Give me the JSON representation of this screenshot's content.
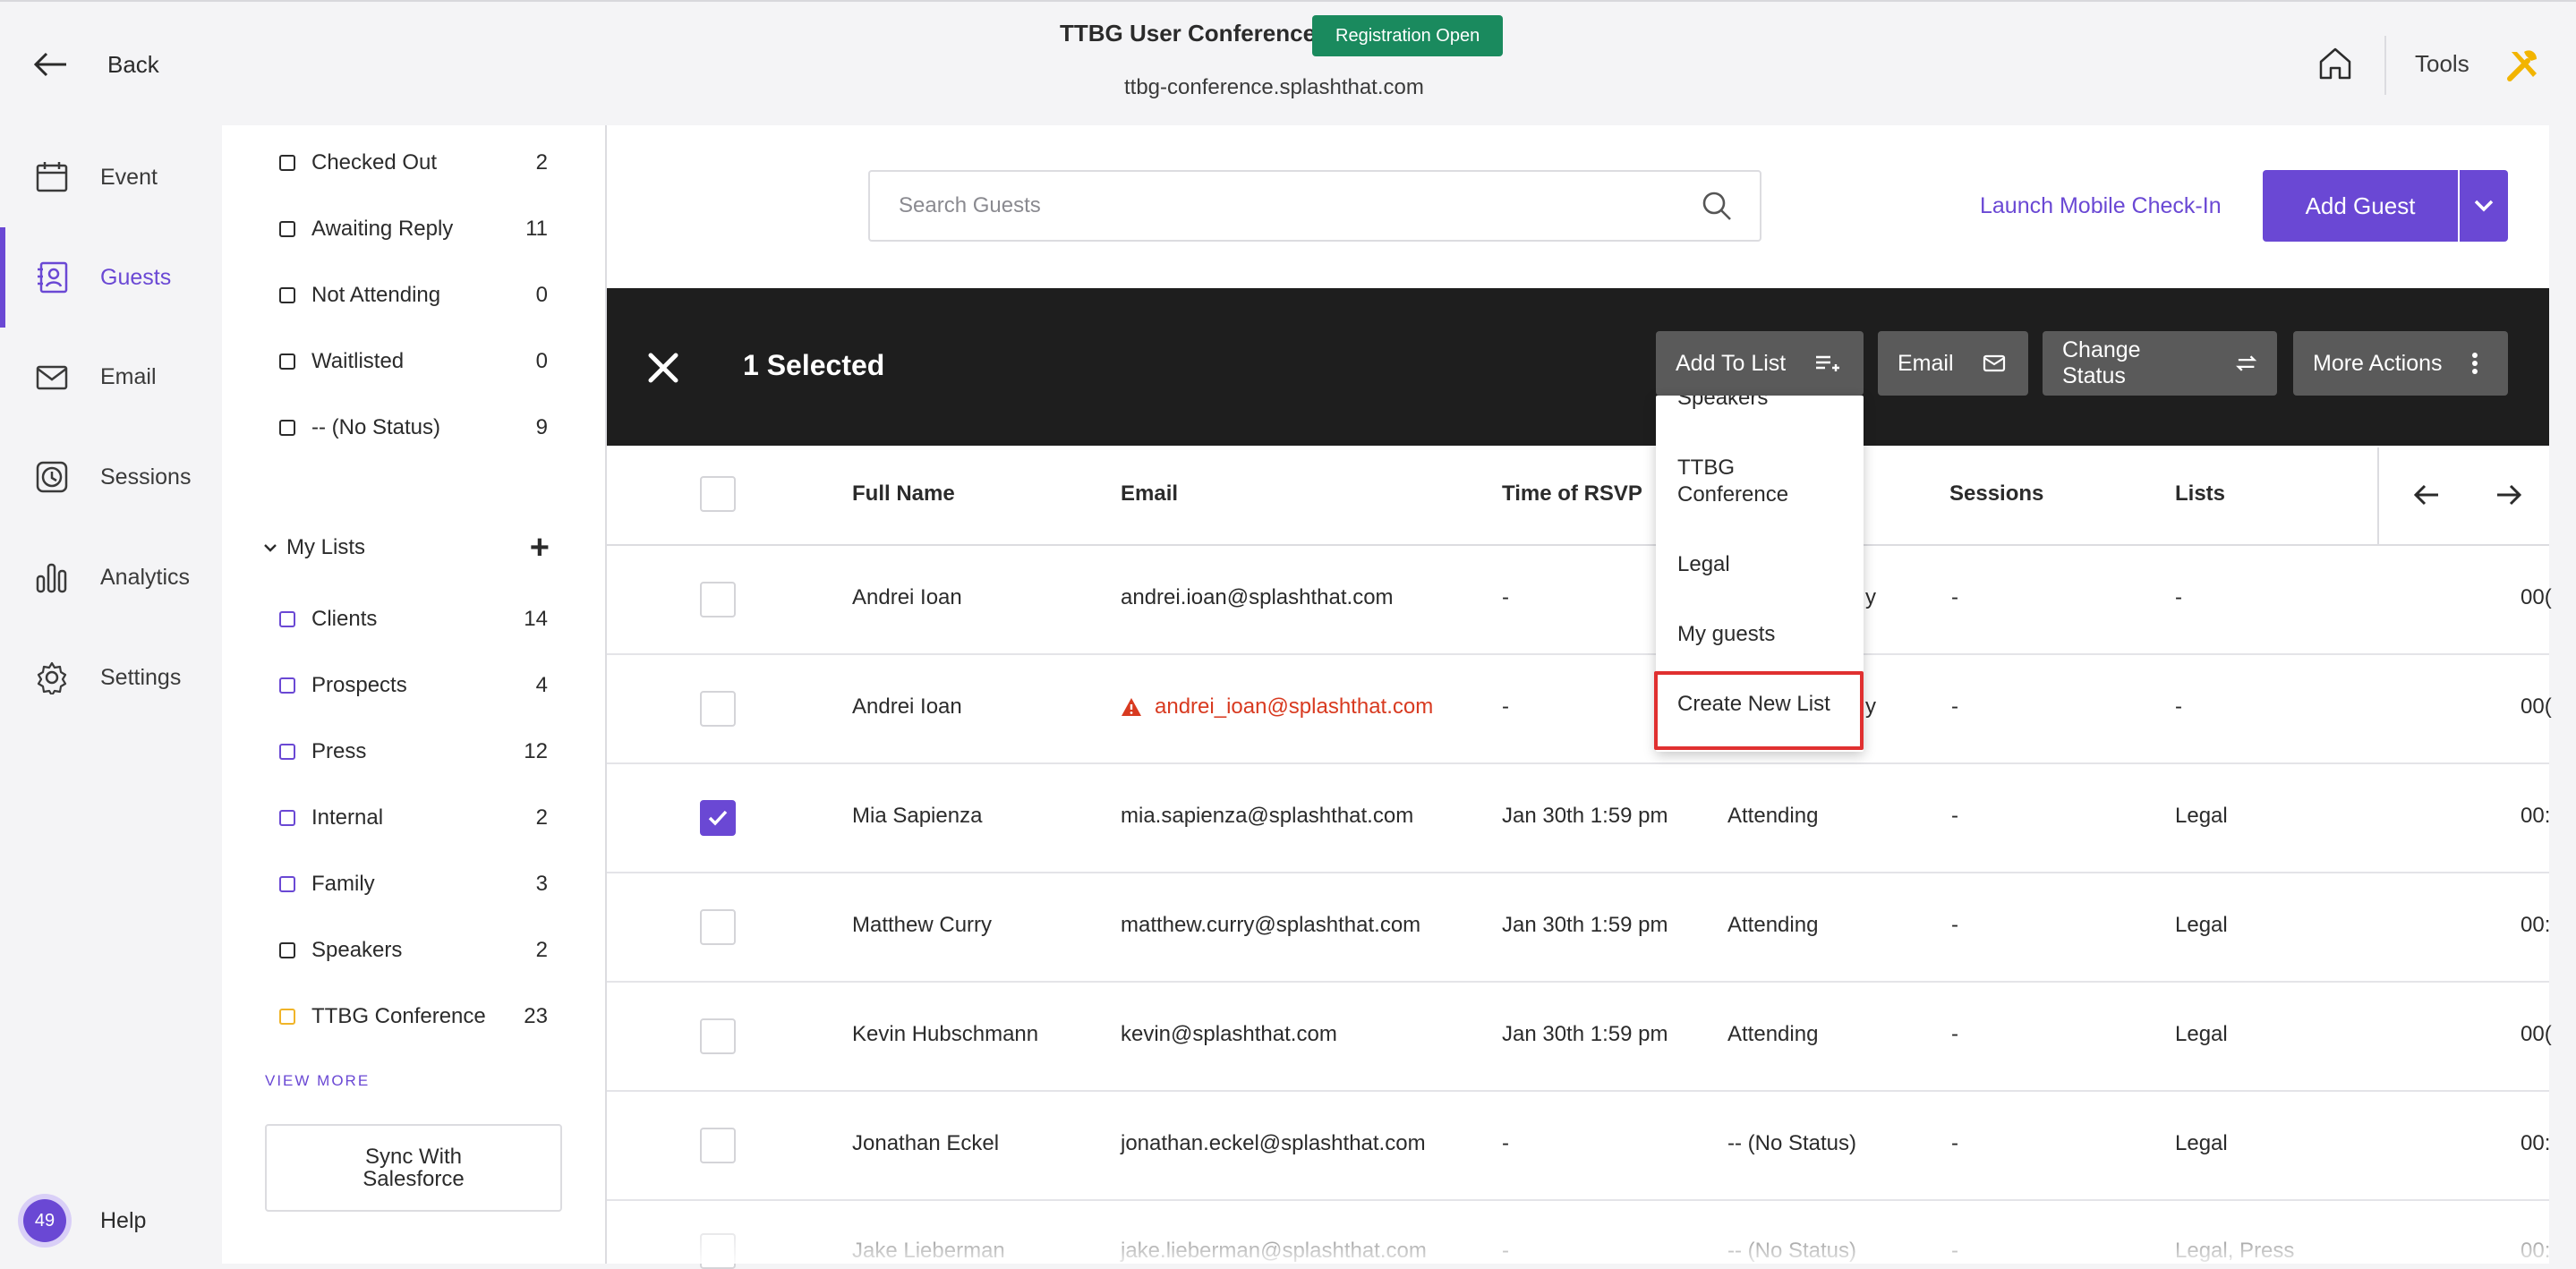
{
  "topbar": {
    "back_label": "Back",
    "event_title": "TTBG User Conference",
    "status_badge": "Registration Open",
    "event_url": "ttbg-conference.splashthat.com",
    "tools_label": "Tools"
  },
  "nav": {
    "items": [
      {
        "label": "Event",
        "icon": "calendar-icon"
      },
      {
        "label": "Guests",
        "icon": "guests-icon",
        "active": true
      },
      {
        "label": "Email",
        "icon": "envelope-icon"
      },
      {
        "label": "Sessions",
        "icon": "clock-icon"
      },
      {
        "label": "Analytics",
        "icon": "bar-chart-icon"
      },
      {
        "label": "Settings",
        "icon": "gear-icon"
      }
    ],
    "help_count": "49",
    "help_label": "Help"
  },
  "filters": {
    "statuses": [
      {
        "label": "Checked Out",
        "count": "2"
      },
      {
        "label": "Awaiting Reply",
        "count": "11"
      },
      {
        "label": "Not Attending",
        "count": "0"
      },
      {
        "label": "Waitlisted",
        "count": "0"
      },
      {
        "label": "-- (No Status)",
        "count": "9"
      }
    ],
    "my_lists_label": "My Lists",
    "lists": [
      {
        "label": "Clients",
        "count": "14"
      },
      {
        "label": "Prospects",
        "count": "4"
      },
      {
        "label": "Press",
        "count": "12"
      },
      {
        "label": "Internal",
        "count": "2"
      },
      {
        "label": "Family",
        "count": "3"
      },
      {
        "label": "Speakers",
        "count": "2"
      },
      {
        "label": "TTBG Conference",
        "count": "23"
      }
    ],
    "view_more": "VIEW MORE",
    "sync_label_line1": "Sync With",
    "sync_label_line2": "Salesforce"
  },
  "toolbar": {
    "search_placeholder": "Search Guests",
    "mobile_checkin": "Launch Mobile Check-In",
    "add_guest": "Add Guest"
  },
  "selection": {
    "selected_label": "1 Selected",
    "add_to_list": "Add To List",
    "email": "Email",
    "change_status": "Change Status",
    "more_actions": "More Actions"
  },
  "dropdown": {
    "items": [
      "Speakers",
      "TTBG Conference",
      "Legal",
      "My guests",
      "Create New List"
    ]
  },
  "table": {
    "columns": [
      "Full Name",
      "Email",
      "Time of RSVP",
      "Sessions",
      "Lists"
    ],
    "rows": [
      {
        "name": "Andrei Ioan",
        "email": "andrei.ioan@splashthat.com",
        "rsvp": "-",
        "status": "y",
        "sessions": "-",
        "lists": "-",
        "extra": "00(",
        "checked": false,
        "warn": false
      },
      {
        "name": "Andrei Ioan",
        "email": "andrei_ioan@splashthat.com",
        "rsvp": "-",
        "status": "y",
        "sessions": "-",
        "lists": "-",
        "extra": "00(",
        "checked": false,
        "warn": true
      },
      {
        "name": "Mia Sapienza",
        "email": "mia.sapienza@splashthat.com",
        "rsvp": "Jan 30th 1:59 pm",
        "status": "Attending",
        "sessions": "-",
        "lists": "Legal",
        "extra": "00:",
        "checked": true,
        "warn": false
      },
      {
        "name": "Matthew Curry",
        "email": "matthew.curry@splashthat.com",
        "rsvp": "Jan 30th 1:59 pm",
        "status": "Attending",
        "sessions": "-",
        "lists": "Legal",
        "extra": "00:",
        "checked": false,
        "warn": false
      },
      {
        "name": "Kevin Hubschmann",
        "email": "kevin@splashthat.com",
        "rsvp": "Jan 30th 1:59 pm",
        "status": "Attending",
        "sessions": "-",
        "lists": "Legal",
        "extra": "00(",
        "checked": false,
        "warn": false
      },
      {
        "name": "Jonathan Eckel",
        "email": "jonathan.eckel@splashthat.com",
        "rsvp": "-",
        "status": "-- (No Status)",
        "sessions": "-",
        "lists": "Legal",
        "extra": "00:",
        "checked": false,
        "warn": false
      },
      {
        "name": "Jake Lieberman",
        "email": "jake.lieberman@splashthat.com",
        "rsvp": "-",
        "status": "-- (No Status)",
        "sessions": "-",
        "lists": "Legal, Press",
        "extra": "00:",
        "checked": false,
        "warn": false
      }
    ]
  },
  "colors": {
    "accent": "#6a48d4",
    "badge_green": "#1a8a5e",
    "selection_bar": "#1e1e1e",
    "warning_red": "#d83a20",
    "highlight_red": "#e03030"
  }
}
